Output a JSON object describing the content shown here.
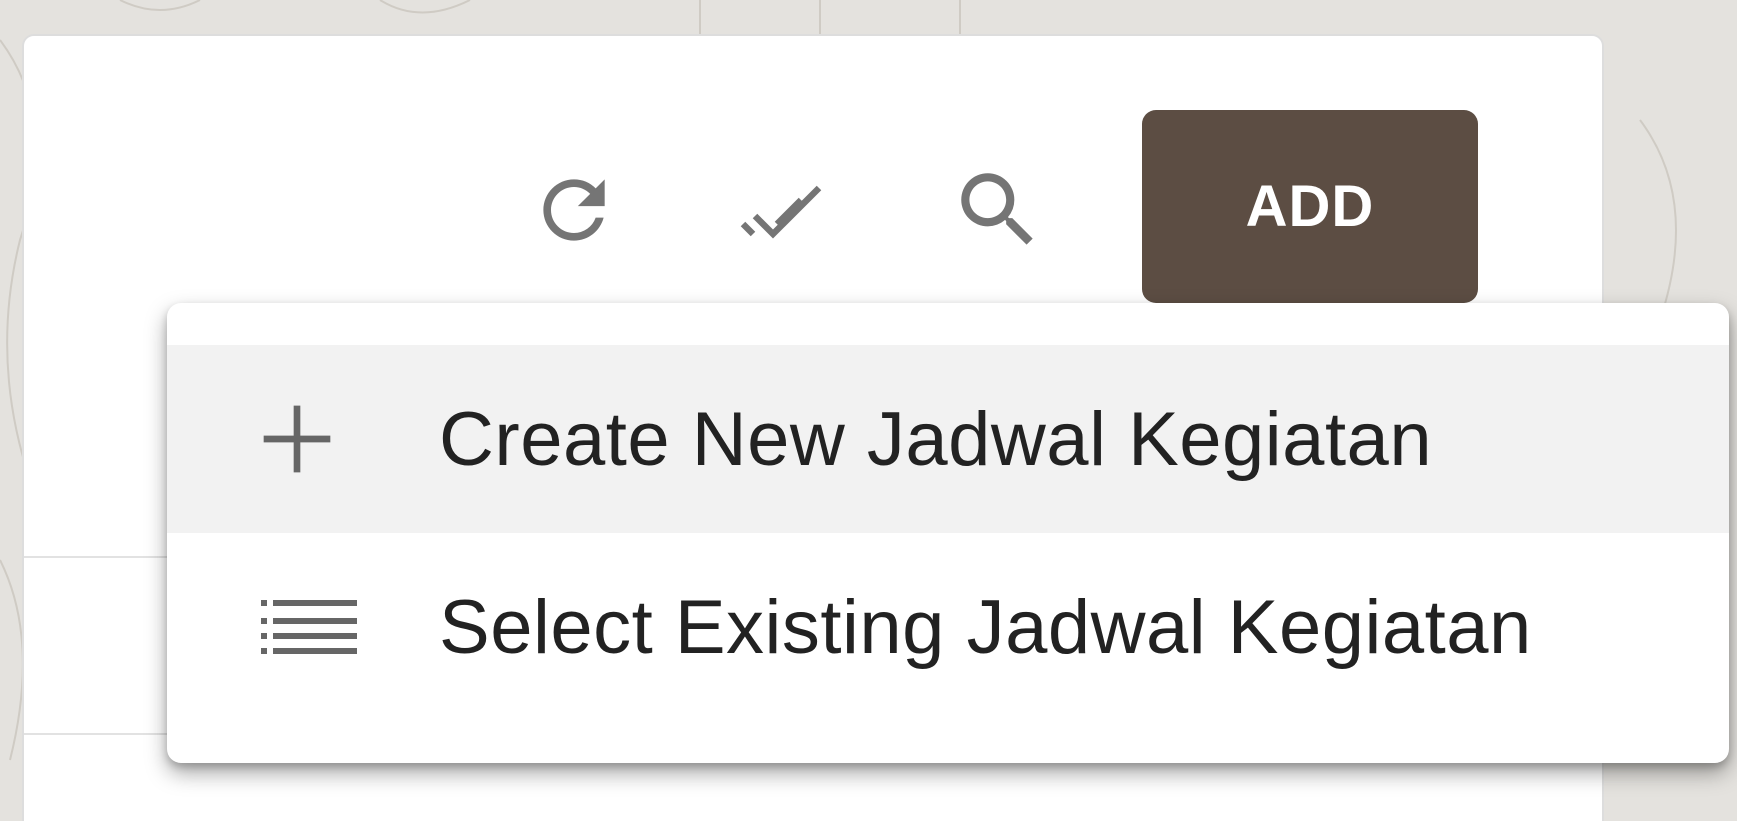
{
  "toolbar": {
    "refresh_icon": "refresh-icon",
    "select_all_icon": "double-check-icon",
    "search_icon": "search-icon",
    "add_label": "ADD",
    "add_color": "#5c4d43"
  },
  "add_menu": {
    "items": [
      {
        "icon": "plus-icon",
        "label": "Create New Jadwal Kegiatan"
      },
      {
        "icon": "list-icon",
        "label": "Select Existing Jadwal Kegiatan"
      }
    ]
  }
}
